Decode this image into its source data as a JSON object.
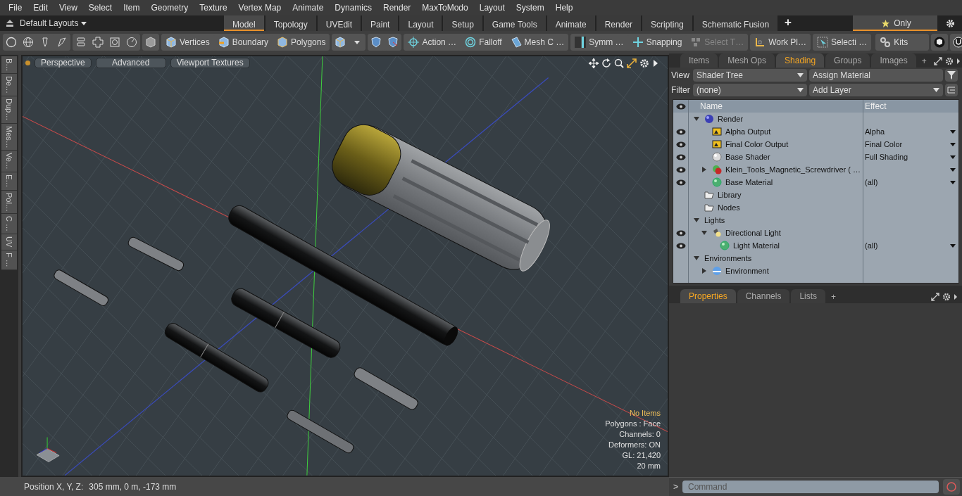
{
  "menu": [
    "File",
    "Edit",
    "View",
    "Select",
    "Item",
    "Geometry",
    "Texture",
    "Vertex Map",
    "Animate",
    "Dynamics",
    "Render",
    "MaxToModo",
    "Layout",
    "System",
    "Help"
  ],
  "layout_bar": {
    "dropdown": "Default Layouts",
    "tabs": [
      {
        "label": "Model",
        "selected": true
      },
      {
        "label": "Topology",
        "selected": false
      },
      {
        "label": "UVEdit",
        "selected": false
      },
      {
        "label": "Paint",
        "selected": false
      },
      {
        "label": "Layout",
        "selected": false
      },
      {
        "label": "Setup",
        "selected": false
      },
      {
        "label": "Game Tools",
        "selected": false
      },
      {
        "label": "Animate",
        "selected": false
      },
      {
        "label": "Render",
        "selected": false
      },
      {
        "label": "Scripting",
        "selected": false
      },
      {
        "label": "Schematic Fusion",
        "selected": false
      }
    ],
    "add": "+",
    "only": "Only"
  },
  "toolbar": [
    {
      "label": "Vertices",
      "kind": "vertices",
      "disabled": false
    },
    {
      "label": "Boundary",
      "kind": "boundary",
      "disabled": false
    },
    {
      "label": "Polygons",
      "kind": "polygons",
      "disabled": false
    },
    {
      "label": "Action …",
      "kind": "action",
      "disabled": false
    },
    {
      "label": "Falloff",
      "kind": "falloff",
      "disabled": false
    },
    {
      "label": "Mesh C …",
      "kind": "mesh",
      "disabled": false
    },
    {
      "label": "Symm …",
      "kind": "symmetry",
      "disabled": false
    },
    {
      "label": "Snapping",
      "kind": "snapping",
      "disabled": false
    },
    {
      "label": "Select T…",
      "kind": "selecttool",
      "disabled": true
    },
    {
      "label": "Work Pl…",
      "kind": "workplane",
      "disabled": false
    },
    {
      "label": "Selecti …",
      "kind": "selection",
      "disabled": false
    },
    {
      "label": "Kits",
      "kind": "kits",
      "disabled": false
    }
  ],
  "side_tabs": [
    "B…",
    "De…",
    "Dup…",
    "Mes…",
    "Ve…",
    "E…",
    "Pol…",
    "C …",
    "UV",
    "F …"
  ],
  "viewport": {
    "buttons": [
      "Perspective",
      "Advanced",
      "Viewport Textures"
    ],
    "info": [
      {
        "text": "No Items",
        "highlight": true
      },
      {
        "text": "Polygons : Face",
        "highlight": false
      },
      {
        "text": "Channels: 0",
        "highlight": false
      },
      {
        "text": "Deformers: ON",
        "highlight": false
      },
      {
        "text": "GL: 21,420",
        "highlight": false
      },
      {
        "text": "20 mm",
        "highlight": false
      }
    ]
  },
  "status_bar": {
    "label": "Position X, Y, Z:",
    "value": "305 mm, 0 m, -173 mm"
  },
  "shading_panel": {
    "tabs": [
      {
        "label": "Items",
        "selected": false
      },
      {
        "label": "Mesh Ops",
        "selected": false
      },
      {
        "label": "Shading",
        "selected": true
      },
      {
        "label": "Groups",
        "selected": false
      },
      {
        "label": "Images",
        "selected": false
      }
    ],
    "add": "+",
    "view_label": "View",
    "view_value": "Shader Tree",
    "assign": "Assign Material",
    "filter_label": "Filter",
    "filter_value": "(none)",
    "add_layer": "Add Layer",
    "columns": [
      "Name",
      "Effect"
    ],
    "tree": [
      {
        "name": "Render",
        "kind": "render",
        "visible": false,
        "expanded": true,
        "dropdown": false,
        "children": [
          {
            "name": "Alpha Output",
            "kind": "output",
            "visible": true,
            "effect": "Alpha",
            "dropdown": true
          },
          {
            "name": "Final Color Output",
            "kind": "output",
            "visible": true,
            "effect": "Final Color",
            "dropdown": true
          },
          {
            "name": "Base Shader",
            "kind": "shader",
            "visible": true,
            "effect": "Full Shading",
            "dropdown": true
          },
          {
            "name": "Klein_Tools_Magnetic_Screwdriver ( …",
            "kind": "mask",
            "visible": true,
            "expanded": false,
            "dropdown": true
          },
          {
            "name": "Base Material",
            "kind": "material",
            "visible": true,
            "effect": "(all)",
            "dropdown": true
          }
        ]
      },
      {
        "name": "Library",
        "kind": "folder",
        "visible": false,
        "dropdown": false
      },
      {
        "name": "Nodes",
        "kind": "folder",
        "visible": false,
        "dropdown": false
      },
      {
        "name": "Lights",
        "kind": "group",
        "visible": false,
        "expanded": true,
        "dropdown": false,
        "children": [
          {
            "name": "Directional Light",
            "kind": "light",
            "visible": true,
            "expanded": true,
            "dropdown": false,
            "children": [
              {
                "name": "Light Material",
                "kind": "material",
                "visible": true,
                "effect": "(all)",
                "dropdown": true
              }
            ]
          }
        ]
      },
      {
        "name": "Environments",
        "kind": "group",
        "visible": false,
        "expanded": true,
        "dropdown": false,
        "children": [
          {
            "name": "Environment",
            "kind": "environment",
            "visible": false,
            "expanded": false,
            "dropdown": false
          }
        ]
      }
    ]
  },
  "properties_panel": {
    "tabs": [
      {
        "label": "Properties",
        "selected": true
      },
      {
        "label": "Channels",
        "selected": false
      },
      {
        "label": "Lists",
        "selected": false
      }
    ],
    "add": "+",
    "prompt": ">",
    "command_placeholder": "Command"
  }
}
